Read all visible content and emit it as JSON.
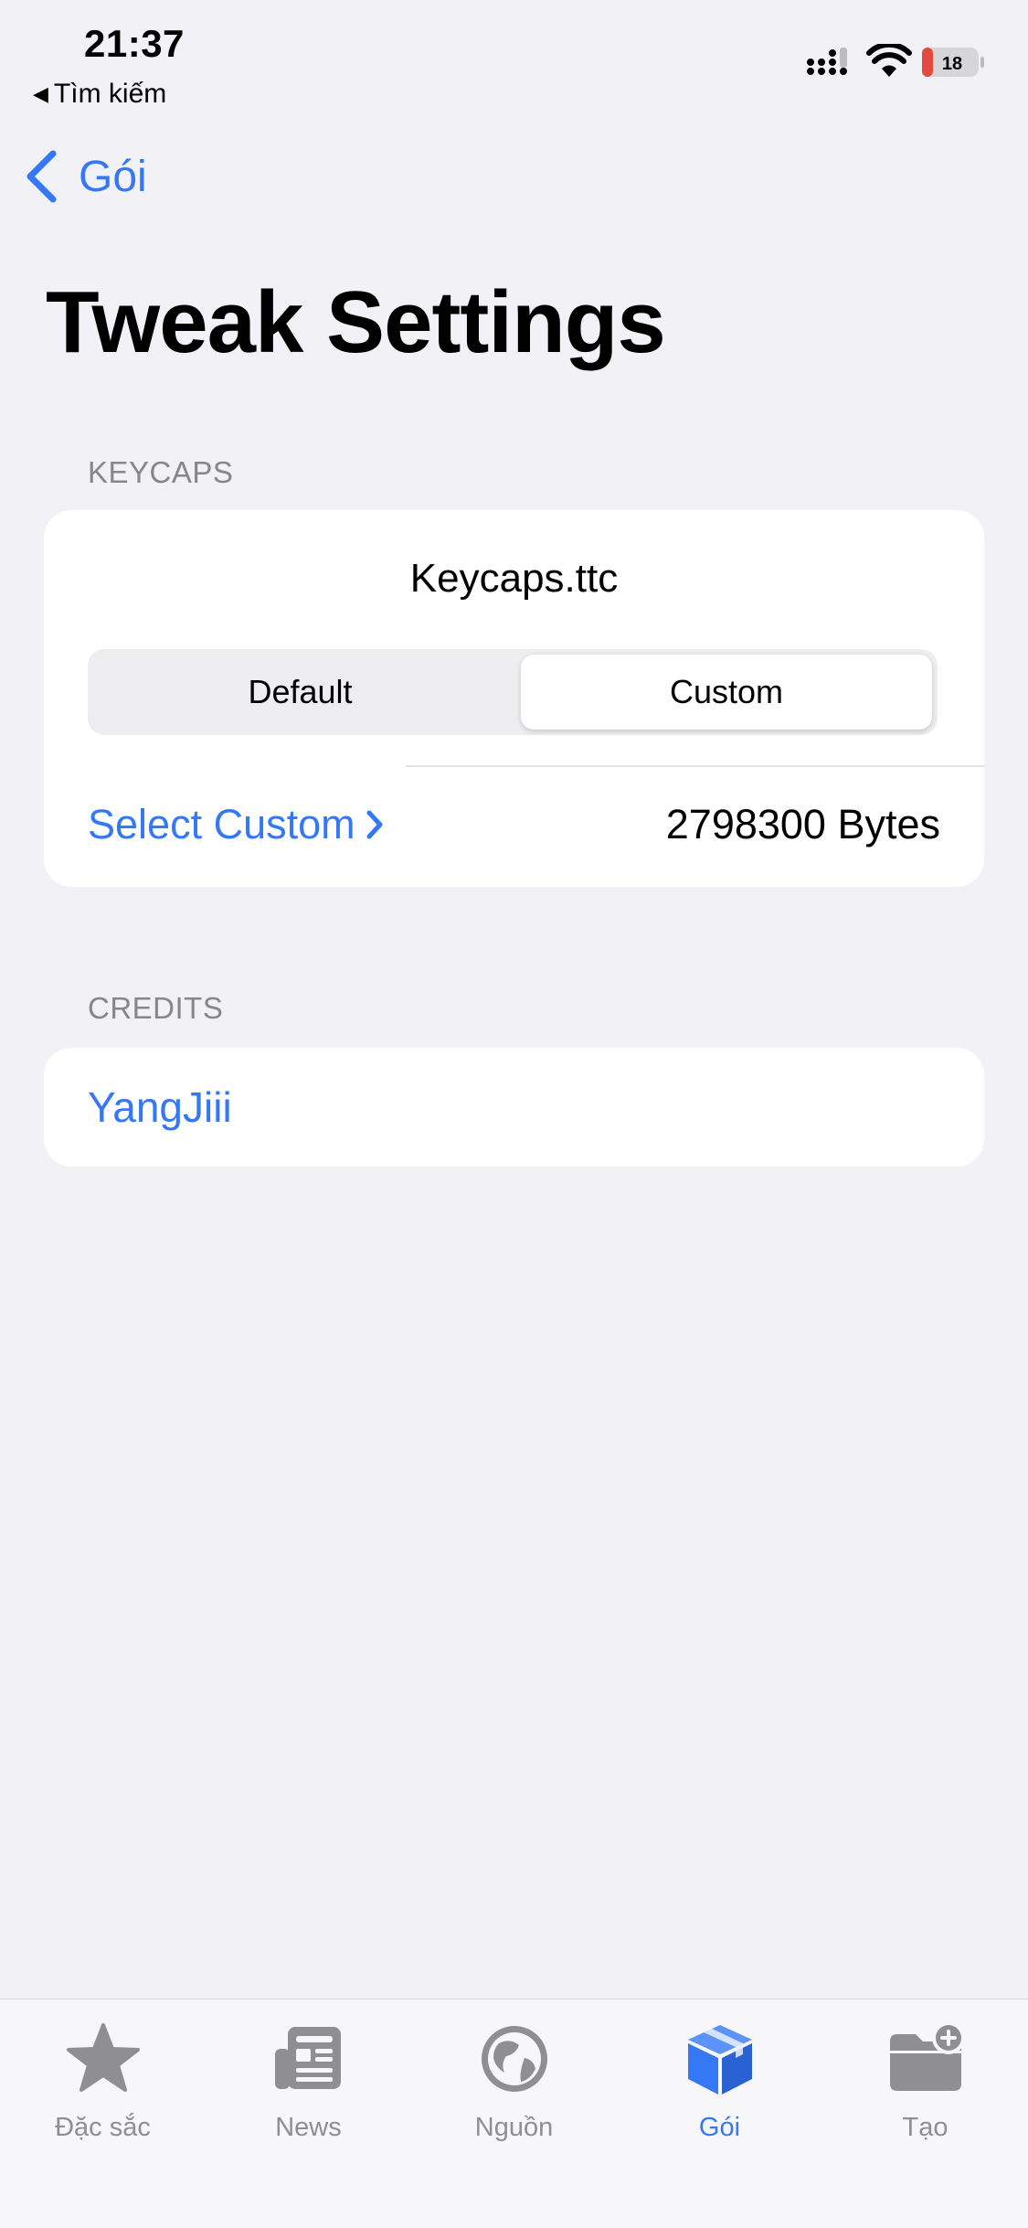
{
  "status_bar": {
    "time": "21:37",
    "back_app_label": "Tìm kiếm",
    "battery_level": "18"
  },
  "nav": {
    "back_label": "Gói"
  },
  "page_title": "Tweak Settings",
  "keycaps": {
    "header": "KEYCAPS",
    "file_name": "Keycaps.ttc",
    "segments": [
      "Default",
      "Custom"
    ],
    "selected_segment": "Custom",
    "select_custom_label": "Select Custom",
    "size_value": "2798300 Bytes"
  },
  "credits": {
    "header": "CREDITS",
    "author": "YangJiii"
  },
  "tab_bar": {
    "items": [
      {
        "label": "Đặc sắc",
        "icon": "star-icon"
      },
      {
        "label": "News",
        "icon": "newspaper-icon"
      },
      {
        "label": "Nguồn",
        "icon": "globe-icon"
      },
      {
        "label": "Gói",
        "icon": "package-icon"
      },
      {
        "label": "Tạo",
        "icon": "folder-add-icon"
      }
    ],
    "active_label": "Gói"
  },
  "colors": {
    "accent": "#3478F6",
    "background": "#F1F1F6",
    "secondary_text": "#86868B",
    "battery_low": "#E5483E"
  }
}
